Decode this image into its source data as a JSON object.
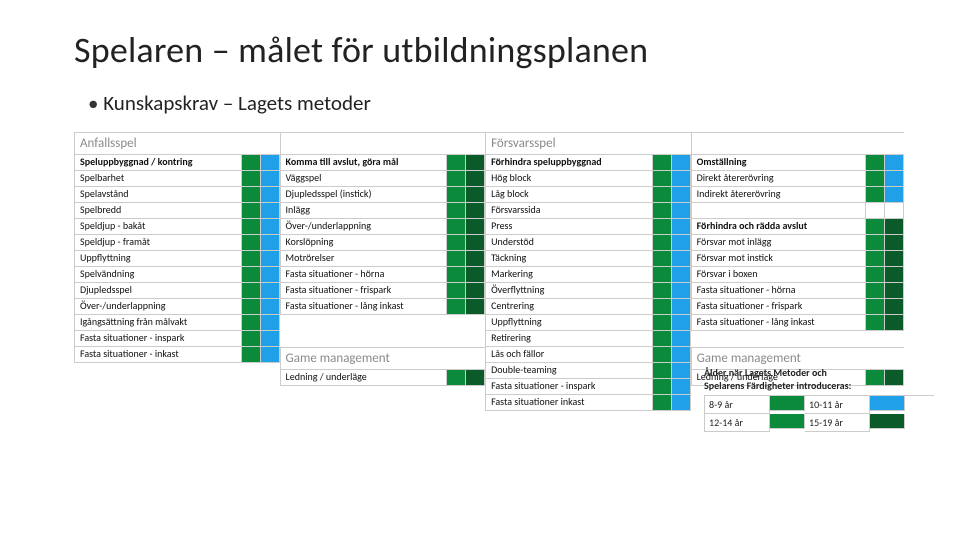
{
  "title": "Spelaren – målet för utbildningsplanen",
  "bullet": "Kunskapskrav – Lagets metoder",
  "palette": {
    "green": "#0a8a3a",
    "dgreen": "#0b5b2a",
    "blue": "#1fa0e8"
  },
  "sections": [
    {
      "header": "Anfallsspel",
      "rows": [
        {
          "label": "Speluppbyggnad / kontring",
          "bold": true,
          "sw": [
            "green",
            "blue"
          ]
        },
        {
          "label": "Spelbarhet",
          "sw": [
            "green",
            "blue"
          ]
        },
        {
          "label": "Spelavstånd",
          "sw": [
            "green",
            "blue"
          ]
        },
        {
          "label": "Spelbredd",
          "sw": [
            "green",
            "blue"
          ]
        },
        {
          "label": "Speldjup - bakåt",
          "sw": [
            "green",
            "blue"
          ]
        },
        {
          "label": "Speldjup - framåt",
          "sw": [
            "green",
            "blue"
          ]
        },
        {
          "label": "Uppflyttning",
          "sw": [
            "green",
            "blue"
          ]
        },
        {
          "label": "Spelvändning",
          "sw": [
            "green",
            "blue"
          ]
        },
        {
          "label": "Djupledsspel",
          "sw": [
            "green",
            "blue"
          ]
        },
        {
          "label": "Över-/underlappning",
          "sw": [
            "green",
            "blue"
          ]
        },
        {
          "label": "Igångsättning från målvakt",
          "sw": [
            "green",
            "blue"
          ]
        },
        {
          "label": "Fasta situationer - inspark",
          "sw": [
            "green",
            "blue"
          ]
        },
        {
          "label": "Fasta situationer - inkast",
          "sw": [
            "green",
            "blue"
          ]
        }
      ]
    },
    {
      "header": "",
      "rows": [
        {
          "label": "Komma till avslut, göra mål",
          "bold": true,
          "sw": [
            "green",
            "dgreen"
          ]
        },
        {
          "label": "Väggspel",
          "sw": [
            "green",
            "dgreen"
          ]
        },
        {
          "label": "Djupledsspel (instick)",
          "sw": [
            "green",
            "dgreen"
          ]
        },
        {
          "label": "Inlägg",
          "sw": [
            "green",
            "dgreen"
          ]
        },
        {
          "label": "Över-/underlappning",
          "sw": [
            "green",
            "dgreen"
          ]
        },
        {
          "label": "Korslöpning",
          "sw": [
            "green",
            "dgreen"
          ]
        },
        {
          "label": "Motrörelser",
          "sw": [
            "green",
            "dgreen"
          ]
        },
        {
          "label": "Fasta situationer - hörna",
          "sw": [
            "green",
            "dgreen"
          ]
        },
        {
          "label": "Fasta situationer - frispark",
          "sw": [
            "green",
            "dgreen"
          ]
        },
        {
          "label": "Fasta situationer - lång inkast",
          "sw": [
            "green",
            "dgreen"
          ]
        }
      ],
      "footer": {
        "header": "Game management",
        "rows": [
          {
            "label": "Ledning / underläge",
            "sw": [
              "green",
              "dgreen"
            ]
          }
        ]
      }
    },
    {
      "header": "Försvarsspel",
      "rows": [
        {
          "label": "Förhindra speluppbyggnad",
          "bold": true,
          "sw": [
            "green",
            "blue"
          ]
        },
        {
          "label": "Hög block",
          "sw": [
            "green",
            "blue"
          ]
        },
        {
          "label": "Låg block",
          "sw": [
            "green",
            "blue"
          ]
        },
        {
          "label": "Försvarssida",
          "sw": [
            "green",
            "blue"
          ]
        },
        {
          "label": "Press",
          "sw": [
            "green",
            "blue"
          ]
        },
        {
          "label": "Understöd",
          "sw": [
            "green",
            "blue"
          ]
        },
        {
          "label": "Täckning",
          "sw": [
            "green",
            "blue"
          ]
        },
        {
          "label": "Markering",
          "sw": [
            "green",
            "blue"
          ]
        },
        {
          "label": "Överflyttning",
          "sw": [
            "green",
            "blue"
          ]
        },
        {
          "label": "Centrering",
          "sw": [
            "green",
            "blue"
          ]
        },
        {
          "label": "Uppflyttning",
          "sw": [
            "green",
            "blue"
          ]
        },
        {
          "label": "Retirering",
          "sw": [
            "green",
            "blue"
          ]
        },
        {
          "label": "Lås och fällor",
          "sw": [
            "green",
            "blue"
          ]
        },
        {
          "label": "Double-teaming",
          "sw": [
            "green",
            "blue"
          ]
        },
        {
          "label": "Fasta situationer - inspark",
          "sw": [
            "green",
            "blue"
          ]
        },
        {
          "label": "Fasta situationer  inkast",
          "sw": [
            "green",
            "blue"
          ]
        }
      ]
    },
    {
      "header": "",
      "rows": [
        {
          "label": "Omställning",
          "bold": true,
          "sw": [
            "green",
            "blue"
          ]
        },
        {
          "label": "Direkt återerövring",
          "sw": [
            "green",
            "blue"
          ]
        },
        {
          "label": "Indirekt återerövring",
          "sw": [
            "green",
            "blue"
          ]
        },
        {
          "label": "",
          "sw": [
            "none",
            "none"
          ],
          "empty": true
        },
        {
          "label": "Förhindra och rädda avslut",
          "bold": true,
          "sw": [
            "green",
            "dgreen"
          ]
        },
        {
          "label": "Försvar mot inlägg",
          "sw": [
            "green",
            "dgreen"
          ]
        },
        {
          "label": "Försvar mot instick",
          "sw": [
            "green",
            "dgreen"
          ]
        },
        {
          "label": "Försvar i boxen",
          "sw": [
            "green",
            "dgreen"
          ]
        },
        {
          "label": "Fasta situationer - hörna",
          "sw": [
            "green",
            "dgreen"
          ]
        },
        {
          "label": "Fasta situationer - frispark",
          "sw": [
            "green",
            "dgreen"
          ]
        },
        {
          "label": "Fasta situationer - lång inkast",
          "sw": [
            "green",
            "dgreen"
          ]
        }
      ],
      "footer": {
        "header": "Game management",
        "rows": [
          {
            "label": "Ledning / underläge",
            "sw": [
              "green",
              "dgreen"
            ]
          }
        ]
      }
    }
  ],
  "legend": {
    "title1": "Ålder när Lagets Metoder och",
    "title2": "Spelarens Färdigheter introduceras:",
    "items": [
      {
        "label": "8-9 år",
        "sw": "green"
      },
      {
        "label": "10-11 år",
        "sw": "blue"
      },
      {
        "label": "12-14 år",
        "sw": "green"
      },
      {
        "label": "15-19 år",
        "sw": "dgreen"
      }
    ]
  }
}
